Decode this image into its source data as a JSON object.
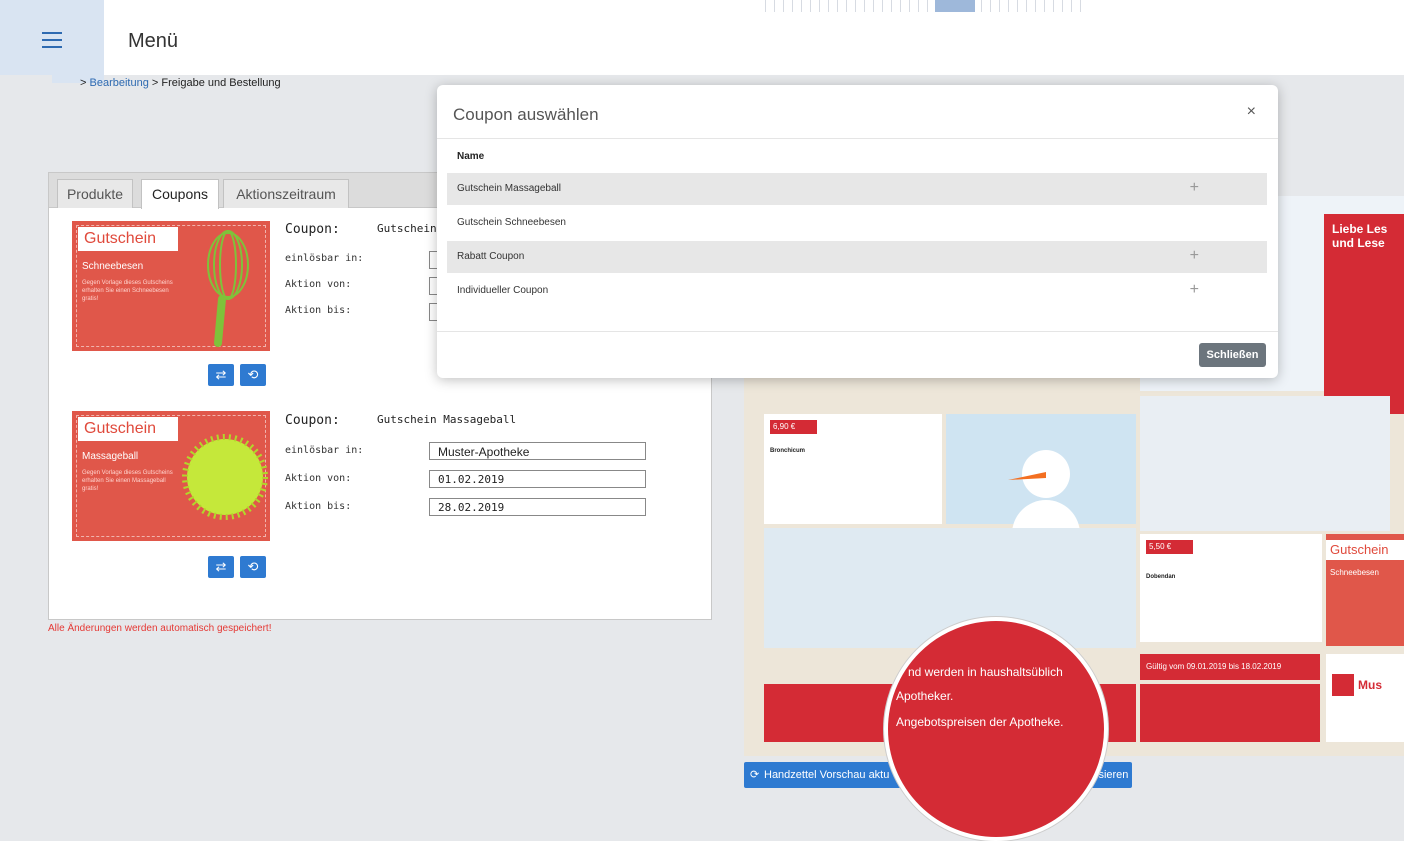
{
  "header": {
    "menu_label": "Menü"
  },
  "breadcrumb": {
    "sep1": ">",
    "item1": "Bearbeitung",
    "sep2": ">",
    "item2": "Freigabe und Bestellung"
  },
  "tabs": [
    "Produkte",
    "Coupons",
    "Aktionszeitraum"
  ],
  "coupon_cards": [
    {
      "image_title": "Gutschein",
      "image_subtitle": "Schneebesen",
      "image_text": "Gegen Vorlage dieses Gutscheins erhalten Sie einen Schneebesen gratis!",
      "coupon_label": "Coupon:",
      "coupon_name": "Gutschein",
      "redeemable_label": "einlösbar in:",
      "from_label": "Aktion von:",
      "to_label": "Aktion bis:"
    },
    {
      "image_title": "Gutschein",
      "image_subtitle": "Massageball",
      "image_text": "Gegen Vorlage dieses Gutscheins erhalten Sie einen Massageball gratis!",
      "coupon_label": "Coupon:",
      "coupon_name": "Gutschein Massageball",
      "redeemable_label": "einlösbar in:",
      "redeemable_value": "Muster-Apotheke",
      "from_label": "Aktion von:",
      "from_value": "01.02.2019",
      "to_label": "Aktion bis:",
      "to_value": "28.02.2019"
    }
  ],
  "autosave_note": "Alle Änderungen werden automatisch gespeichert!",
  "modal": {
    "title": "Coupon auswählen",
    "close_icon": "×",
    "column_header": "Name",
    "rows": [
      {
        "name": "Gutschein Massageball",
        "action": "+"
      },
      {
        "name": "Gutschein Schneebesen",
        "action": ""
      },
      {
        "name": "Rabatt Coupon",
        "action": "+"
      },
      {
        "name": "Individueller Coupon",
        "action": "+"
      }
    ],
    "close_button": "Schließen"
  },
  "preview": {
    "headline": "Liebe Les und Lese",
    "price1": "6,90 €",
    "price2": "5,50 €",
    "product1": "Bronchicum",
    "product2": "Dobendan",
    "coupon_title": "Gutschein",
    "coupon_sub": "Schneebesen",
    "valid": "Gültig vom 09.01.2019 bis 18.02.2019",
    "brand": "Mus",
    "magnifier_lines": [
      "nd werden in haushaltsüblich",
      "Apotheker.",
      "Angebotspreisen der Apotheke."
    ]
  },
  "preview_button": {
    "left": "Handzettel Vorschau aktu",
    "right": "isieren"
  },
  "colors": {
    "accent": "#2e7ad1",
    "coupon": "#e0574a",
    "preview_red": "#d42b35"
  },
  "icons": {
    "swap": "⇄",
    "repeat": "⟲"
  }
}
